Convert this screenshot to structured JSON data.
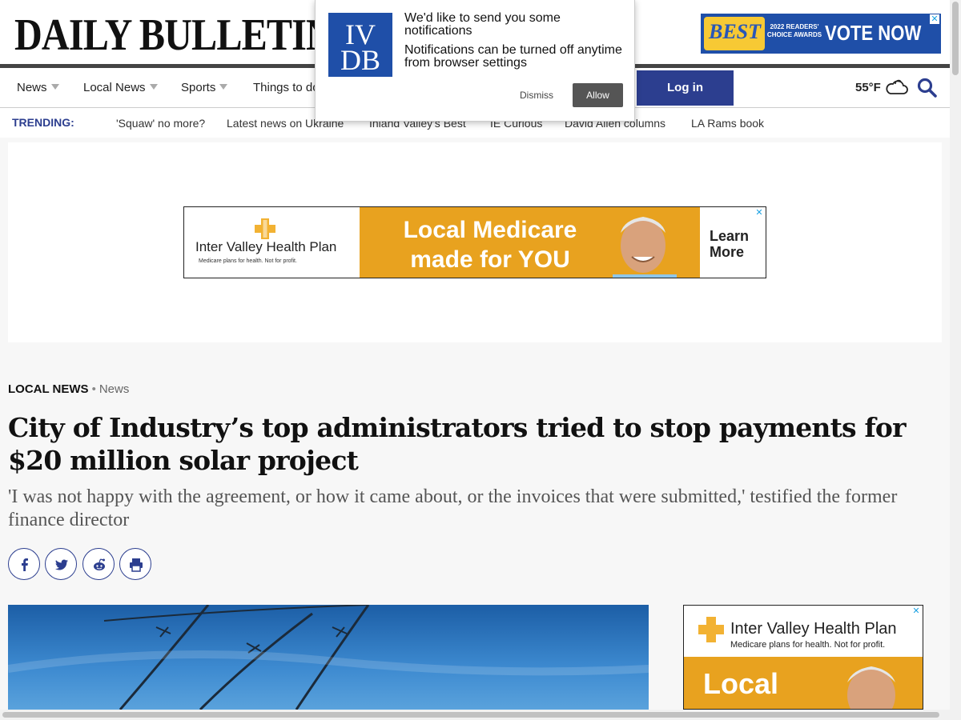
{
  "masthead": {
    "logo": "DAILY BULLETIN"
  },
  "top_ad": {
    "best": "BEST",
    "readers": "2022 READERS' CHOICE AWARDS",
    "cta": "VOTE NOW"
  },
  "nav": {
    "items": [
      {
        "label": "News",
        "has_dropdown": true
      },
      {
        "label": "Local News",
        "has_dropdown": true
      },
      {
        "label": "Sports",
        "has_dropdown": true
      },
      {
        "label": "Things to do",
        "has_dropdown": false
      }
    ],
    "login": "Log in",
    "weather": "55°F",
    "accent_color": "#2c3e8f"
  },
  "trending": {
    "label": "TRENDING:",
    "items": [
      "'Squaw' no more?",
      "Latest news on Ukraine",
      "Inland Valley's Best",
      "IE Curious",
      "David Allen columns",
      "LA Rams book"
    ]
  },
  "leader_ad": {
    "brand": "Inter Valley Health Plan",
    "tagline": "Medicare plans for health. Not for profit.",
    "headline_1": "Local Medicare",
    "headline_2": "made for YOU",
    "cta_1": "Learn",
    "cta_2": "More"
  },
  "article": {
    "section": "LOCAL NEWS",
    "separator": "•",
    "subsection": "News",
    "headline": "City of Industry’s top administrators tried to stop payments for $20 million solar project",
    "subhead": "'I was not happy with the agreement, or how it came about, or the invoices that were submitted,' testified the former finance director"
  },
  "side_ad": {
    "brand": "Inter Valley Health Plan",
    "tagline": "Medicare plans for health. Not for profit.",
    "headline": "Local"
  },
  "popup": {
    "logo_line1": "IV",
    "logo_line2": "DB",
    "message": "We'd like to send you some notifications",
    "detail": "Notifications can be turned off anytime from browser settings",
    "dismiss": "Dismiss",
    "allow": "Allow"
  },
  "ad_close": "✕"
}
